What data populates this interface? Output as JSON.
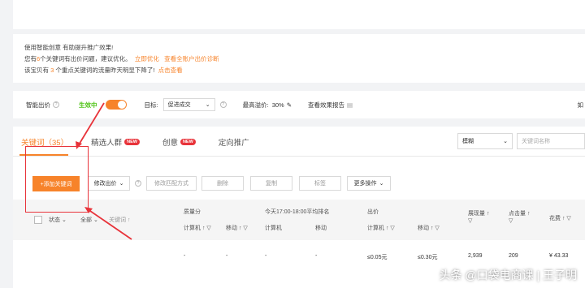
{
  "tips": {
    "line1": "使用智能创意 有助提升推广效果!",
    "line2_pre": "您有",
    "line2_num": "6",
    "line2_mid": "个关键词有出价问题，建议优化。",
    "line2_link1": "立即优化",
    "line2_link2": "查看全账户出价诊断",
    "line3_pre": "该宝贝有",
    "line3_num": "3",
    "line3_mid": "个重点关键词的流量昨天明显下降了!",
    "line3_link": "点击查看"
  },
  "bid_bar": {
    "smart_bid_label": "智能出价",
    "status": "生效中",
    "target_label": "目标:",
    "target_value": "促进成交",
    "max_premium_label": "最高溢价:",
    "max_premium_value": "30%",
    "report_link": "查看效果报告",
    "cut_text": "如"
  },
  "tabs": [
    {
      "label": "关键词（35）",
      "badge": ""
    },
    {
      "label": "精选人群",
      "badge": "NEW"
    },
    {
      "label": "创意",
      "badge": "NEW"
    },
    {
      "label": "定向推广",
      "badge": ""
    }
  ],
  "filters": {
    "match_select": "模糊",
    "search_placeholder": "关键词名称"
  },
  "toolbar": {
    "add_keyword": "+添加关键词",
    "modify_bid": "修改出价",
    "modify_match": "修改匹配方式",
    "delete": "删除",
    "copy": "复制",
    "tag": "标签",
    "more": "更多操作"
  },
  "table": {
    "status": "状态",
    "all": "全部",
    "keyword": "关键词",
    "quality_score": "质量分",
    "ranking": "今天17:00-18:00平均排名",
    "bid": "出价",
    "impressions": "展现量",
    "clicks": "点击量",
    "spend": "花费",
    "computer": "计算机",
    "mobile": "移动"
  },
  "row": {
    "q_pc": "-",
    "q_mobile": "-",
    "rank_pc": "-",
    "rank_mobile": "-",
    "bid_pc": "≤0.05元",
    "bid_mobile": "≤0.30元",
    "impressions": "2,939",
    "clicks": "209",
    "spend": "¥ 43.33"
  },
  "watermark": "头条 @口袋电商课 | 王子明",
  "colors": {
    "accent": "#f7832a",
    "annotation": "#e8333a",
    "badge": "#e8333a"
  }
}
